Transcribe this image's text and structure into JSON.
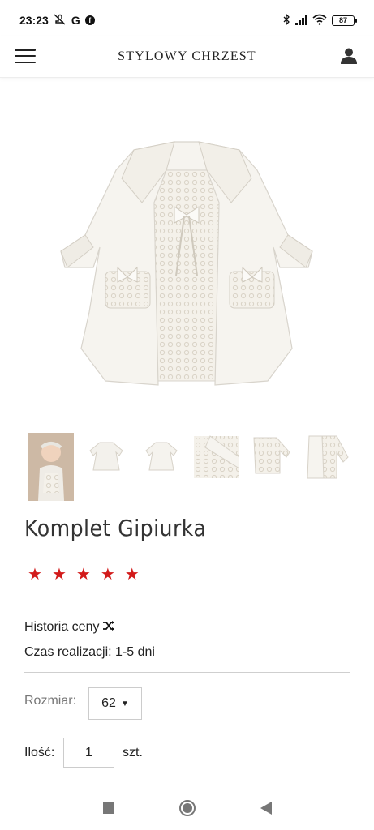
{
  "status_bar": {
    "time": "23:23",
    "battery": "87",
    "icons": [
      "mute-icon",
      "google-icon",
      "facebook-icon",
      "bluetooth-icon",
      "signal-icon",
      "wifi-icon",
      "battery-icon"
    ]
  },
  "header": {
    "brand": "STYLOWY CHRZEST",
    "menu_icon": "hamburger-menu-icon",
    "user_icon": "user-icon"
  },
  "product": {
    "title": "Komplet Gipiurka",
    "rating": 5,
    "rating_max": 5,
    "star_glyph": "★",
    "price_history_label": "Historia ceny",
    "lead_time_label": "Czas realizacji:",
    "lead_time_value": "1-5 dni",
    "size_label": "Rozmiar:",
    "size_value": "62",
    "quantity_label": "Ilość:",
    "quantity_value": "1",
    "quantity_unit": "szt."
  },
  "thumbnails": [
    "baby-photo",
    "dress-front",
    "dress-back",
    "sleeve-detail",
    "lace-detail",
    "coat-detail"
  ],
  "colors": {
    "accent_star": "#d21a1a",
    "text": "#222222",
    "muted": "#777777"
  },
  "nav_bar": {
    "icons": [
      "recents-square-icon",
      "home-circle-icon",
      "back-triangle-icon"
    ]
  }
}
